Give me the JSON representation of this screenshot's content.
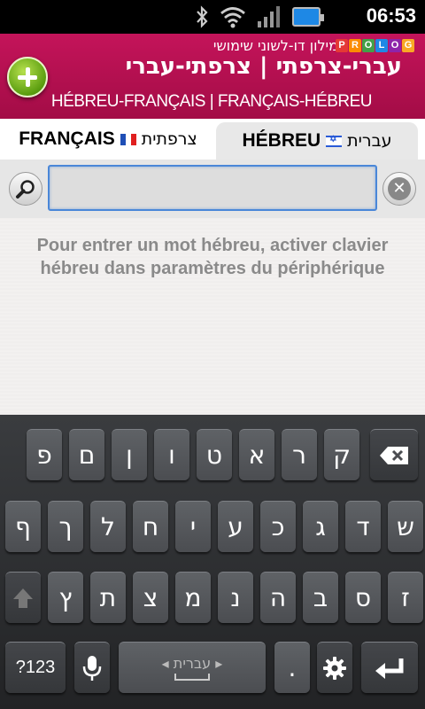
{
  "status_bar": {
    "time": "06:53",
    "icons": [
      "bluetooth-icon",
      "wifi-icon",
      "signal-icon",
      "battery-icon"
    ]
  },
  "header": {
    "subtitle": "מילון דו-לשוני שימושי",
    "logo_letters": [
      "P",
      "R",
      "O",
      "L",
      "O",
      "G"
    ],
    "logo_colors": [
      "#e53935",
      "#fb8c00",
      "#43a047",
      "#1e88e5",
      "#8e24aa",
      "#fdd835"
    ],
    "title_he": "עברי-צרפתי | צרפתי-עברי",
    "title_fr": "HÉBREU-FRANÇAIS | FRANÇAIS-HÉBREU",
    "background_color": "#b5104f"
  },
  "tabs": {
    "francais": {
      "label_latin": "FRANÇAIS",
      "label_hebrew": "צרפתית"
    },
    "hebreu": {
      "label_latin": "HÉBREU",
      "label_hebrew": "עברית",
      "selected": true
    }
  },
  "search": {
    "value": "",
    "placeholder": ""
  },
  "info_message": "Pour entrer un mot hébreu, activer clavier hébreu dans paramètres du périphérique",
  "keyboard": {
    "row1": [
      "פ",
      "ם",
      "ן",
      "ו",
      "ט",
      "א",
      "ר",
      "ק"
    ],
    "row2": [
      "ף",
      "ך",
      "ל",
      "ח",
      "י",
      "ע",
      "כ",
      "ג",
      "ד",
      "ש"
    ],
    "row3": [
      "ץ",
      "ת",
      "צ",
      "מ",
      "נ",
      "ה",
      "ב",
      "ס",
      "ז"
    ],
    "symbols_label": "?123",
    "space_language": "עברית",
    "period": "."
  }
}
